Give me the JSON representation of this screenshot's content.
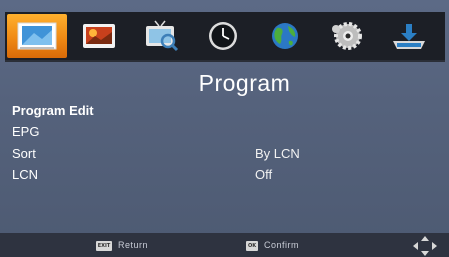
{
  "tabs": [
    {
      "icon": "picture-icon",
      "active": true
    },
    {
      "icon": "photo-icon",
      "active": false
    },
    {
      "icon": "tv-search-icon",
      "active": false
    },
    {
      "icon": "clock-icon",
      "active": false
    },
    {
      "icon": "globe-icon",
      "active": false
    },
    {
      "icon": "gear-icon",
      "active": false
    },
    {
      "icon": "usb-download-icon",
      "active": false
    }
  ],
  "page": {
    "title": "Program"
  },
  "menu": [
    {
      "label": "Program Edit",
      "value": ""
    },
    {
      "label": "EPG",
      "value": ""
    },
    {
      "label": "Sort",
      "value": "By LCN"
    },
    {
      "label": "LCN",
      "value": "Off"
    }
  ],
  "footer": {
    "exit_key": "EXIT",
    "return_label": "Return",
    "ok_key": "OK",
    "confirm_label": "Confirm"
  },
  "colors": {
    "active_tab": "#f08a14",
    "background": "#55627c",
    "tabbar": "#1c1f26"
  }
}
